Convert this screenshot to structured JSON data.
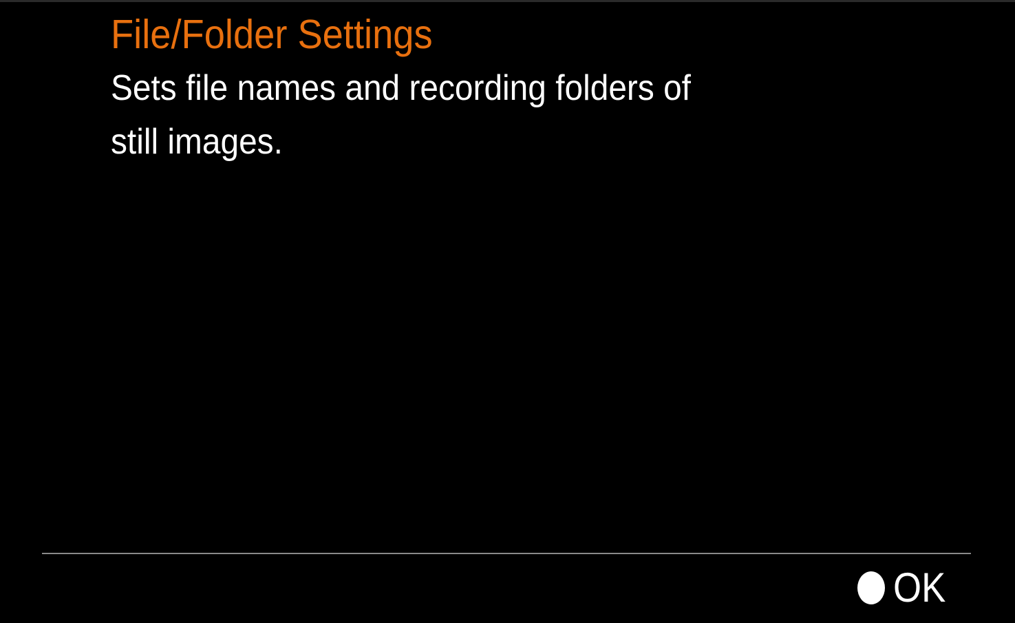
{
  "screen": {
    "title": "File/Folder Settings",
    "description": "Sets file names and recording folders of still images.",
    "title_color": "#e8700f",
    "background_color": "#000000"
  },
  "footer": {
    "ok_icon": "filled-circle-icon",
    "ok_label": "OK"
  }
}
